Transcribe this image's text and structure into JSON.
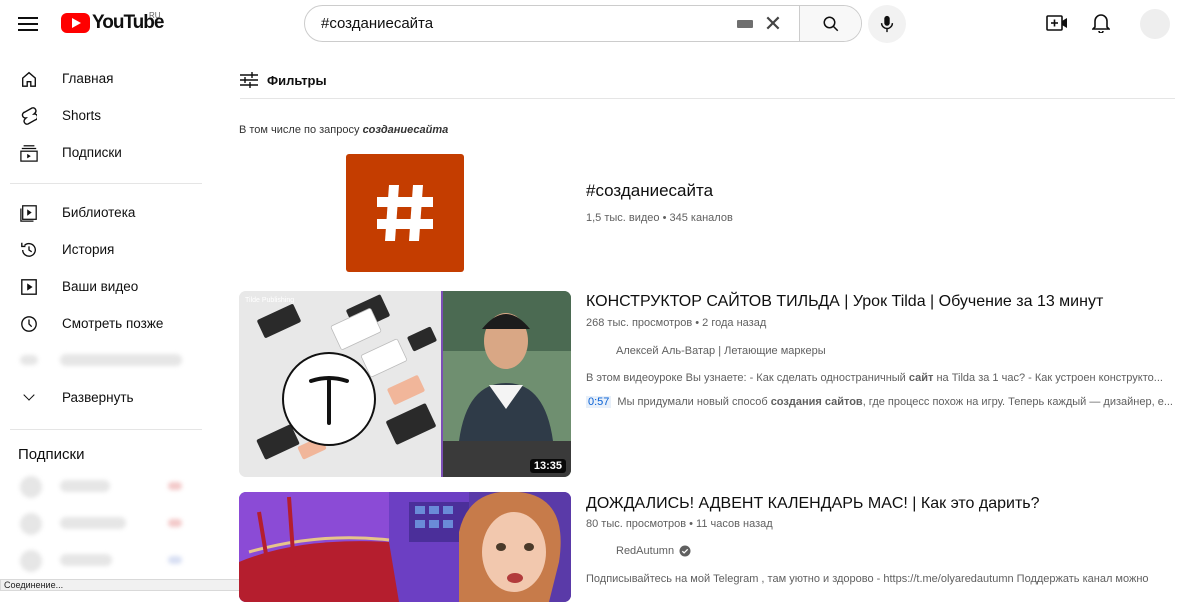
{
  "header": {
    "logo_text": "YouTube",
    "logo_region": "RU",
    "search_value": "#созданиесайта"
  },
  "sidebar": {
    "main_items": [
      {
        "label": "Главная",
        "icon": "home-icon"
      },
      {
        "label": "Shorts",
        "icon": "shorts-icon"
      },
      {
        "label": "Подписки",
        "icon": "subscriptions-icon"
      }
    ],
    "library_items": [
      {
        "label": "Библиотека",
        "icon": "library-icon"
      },
      {
        "label": "История",
        "icon": "history-icon"
      },
      {
        "label": "Ваши видео",
        "icon": "your-videos-icon"
      },
      {
        "label": "Смотреть позже",
        "icon": "watch-later-icon"
      },
      {
        "label": "Развернуть",
        "icon": "chevron-down-icon"
      }
    ],
    "subscriptions_heading": "Подписки"
  },
  "filters_label": "Фильтры",
  "included_query": {
    "prefix": "В том числе по запросу",
    "query": "созданиесайта"
  },
  "hashtag": {
    "title": "#созданиесайта",
    "meta": "1,5 тыс. видео • 345 каналов",
    "color": "#c43d00"
  },
  "videos": [
    {
      "title": "КОНСТРУКТОР САЙТОВ ТИЛЬДА | Урок Tilda | Обучение за 13 минут",
      "meta": "268 тыс. просмотров • 2 года назад",
      "channel": "Алексей Аль-Ватар | Летающие маркеры",
      "desc_prefix": "В этом видеоуроке Вы узнаете: - Как сделать одностраничный ",
      "desc_bold": "сайт",
      "desc_suffix": " на Tilda за 1 час? - Как устроен конструкто...",
      "chapter_time": "0:57",
      "chapter_prefix": "Мы придумали новый способ ",
      "chapter_bold": "создания сайтов",
      "chapter_suffix": ", где процесс похож на игру. Теперь каждый — дизайнер, е...",
      "duration": "13:35",
      "thumb_caption": "Tilde Publishing"
    },
    {
      "title": "ДОЖДАЛИСЬ! АДВЕНТ КАЛЕНДАРЬ MAC! | Как это дарить?",
      "meta": "80 тыс. просмотров • 11 часов назад",
      "channel": "RedAutumn",
      "desc": "Подписывайтесь на мой Telegram , там уютно и здорово - https://t.me/olyaredautumn Поддержать канал можно"
    }
  ],
  "status_bar": "Соединение..."
}
